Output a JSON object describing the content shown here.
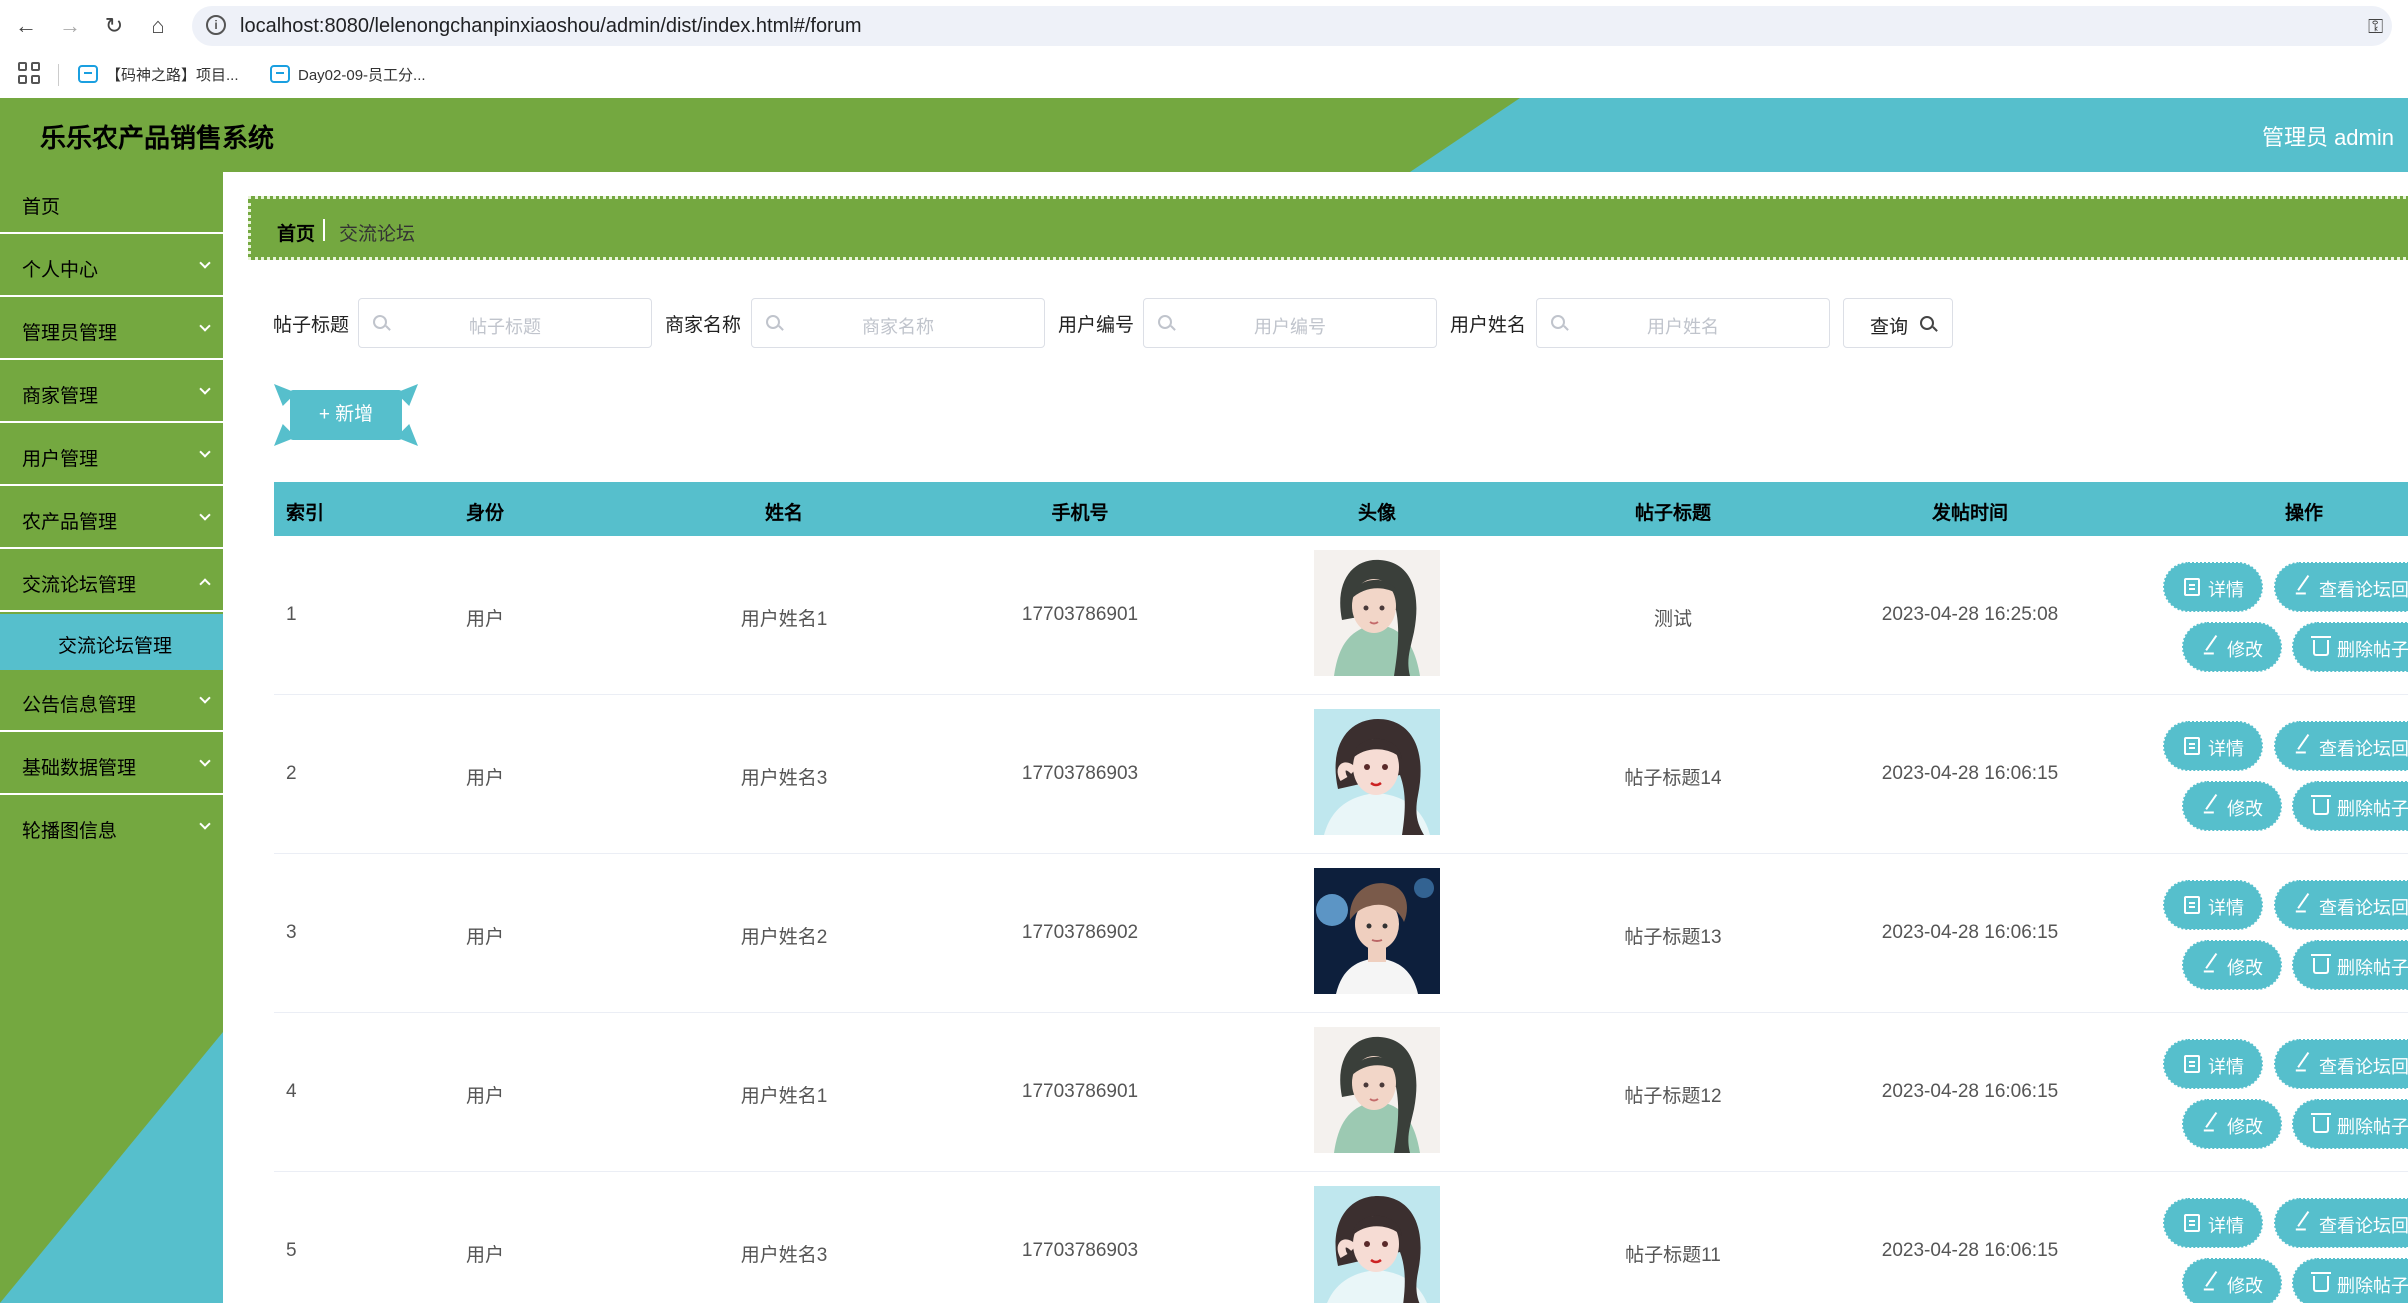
{
  "browser": {
    "url": "localhost:8080/lelenongchanpinxiaoshou/admin/dist/index.html#/forum",
    "bookmarks": [
      "【码神之路】项目...",
      "Day02-09-员工分..."
    ]
  },
  "header": {
    "title": "乐乐农产品销售系统",
    "user": "管理员 admin"
  },
  "sidebar": {
    "items": [
      {
        "label": "首页"
      },
      {
        "label": "个人中心"
      },
      {
        "label": "管理员管理"
      },
      {
        "label": "商家管理"
      },
      {
        "label": "用户管理"
      },
      {
        "label": "农产品管理"
      },
      {
        "label": "交流论坛管理"
      },
      {
        "label": "公告信息管理"
      },
      {
        "label": "基础数据管理"
      },
      {
        "label": "轮播图信息"
      }
    ],
    "submenu_label": "交流论坛管理"
  },
  "breadcrumb": {
    "home": "首页",
    "current": "交流论坛"
  },
  "search": {
    "fields": [
      {
        "label": "帖子标题",
        "placeholder": "帖子标题"
      },
      {
        "label": "商家名称",
        "placeholder": "商家名称"
      },
      {
        "label": "用户编号",
        "placeholder": "用户编号"
      },
      {
        "label": "用户姓名",
        "placeholder": "用户姓名"
      }
    ],
    "query_label": "查询"
  },
  "add_label": "+ 新增",
  "table": {
    "headers": [
      "索引",
      "身份",
      "姓名",
      "手机号",
      "头像",
      "帖子标题",
      "发帖时间",
      "操作"
    ],
    "rows": [
      {
        "index": "1",
        "role": "用户",
        "name": "用户姓名1",
        "phone": "17703786901",
        "avatar": "girl-green",
        "title": "测试",
        "time": "2023-04-28 16:25:08"
      },
      {
        "index": "2",
        "role": "用户",
        "name": "用户姓名3",
        "phone": "17703786903",
        "avatar": "girl-teal",
        "title": "帖子标题14",
        "time": "2023-04-28 16:06:15"
      },
      {
        "index": "3",
        "role": "用户",
        "name": "用户姓名2",
        "phone": "17703786902",
        "avatar": "boy-stage",
        "title": "帖子标题13",
        "time": "2023-04-28 16:06:15"
      },
      {
        "index": "4",
        "role": "用户",
        "name": "用户姓名1",
        "phone": "17703786901",
        "avatar": "girl-green",
        "title": "帖子标题12",
        "time": "2023-04-28 16:06:15"
      },
      {
        "index": "5",
        "role": "用户",
        "name": "用户姓名3",
        "phone": "17703786903",
        "avatar": "girl-teal",
        "title": "帖子标题11",
        "time": "2023-04-28 16:06:15"
      }
    ],
    "actions": {
      "detail": "详情",
      "view_replies": "查看论坛回复",
      "edit": "修改",
      "delete": "删除帖子"
    }
  },
  "colors": {
    "green": "#74a840",
    "teal": "#56bfcc"
  }
}
